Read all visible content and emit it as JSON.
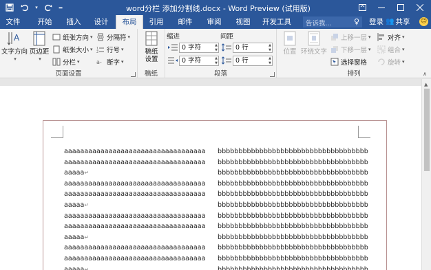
{
  "window": {
    "title": "word分栏 添加分割线.docx - Word Preview (试用版)",
    "qat": {
      "save_icon": "save-icon",
      "undo_icon": "undo-icon",
      "redo_icon": "redo-icon",
      "customize_icon": "customize-qat-icon"
    },
    "controls": {
      "restore": "ribbon-display-icon",
      "minimize": "minimize-icon",
      "maximize": "maximize-icon",
      "close": "close-icon"
    }
  },
  "tabs": [
    "文件",
    "开始",
    "插入",
    "设计",
    "布局",
    "引用",
    "邮件",
    "审阅",
    "视图",
    "开发工具"
  ],
  "active_tab": "布局",
  "tellme": {
    "placeholder": "告诉我..."
  },
  "account": {
    "signin": "登录",
    "share": "共享"
  },
  "ribbon": {
    "page_setup": {
      "label": "页面设置",
      "text_direction": "文字方向",
      "margins": "页边距",
      "orientation": "纸张方向",
      "size": "纸张大小",
      "columns": "分栏",
      "breaks": "分隔符",
      "line_numbers": "行号",
      "hyphenation": "断字"
    },
    "manuscript": {
      "label": "稿纸",
      "button": "稿纸\n设置"
    },
    "paragraph": {
      "label": "段落",
      "indent_title": "缩进",
      "spacing_title": "间距",
      "indent_left": "0 字符",
      "indent_right": "0 字符",
      "spacing_before": "0 行",
      "spacing_after": "0 行"
    },
    "arrange": {
      "label": "排列",
      "position": "位置",
      "wrap_text": "环绕文字",
      "bring_forward": "上移一层",
      "send_backward": "下移一层",
      "selection_pane": "选择窗格",
      "align": "对齐",
      "group": "组合",
      "rotate": "旋转"
    }
  },
  "document": {
    "left_column": [
      "aaaaaaaaaaaaaaaaaaaaaaaaaaaaaaaaaaa",
      "aaaaaaaaaaaaaaaaaaaaaaaaaaaaaaaaaaa",
      "aaaaa",
      "aaaaaaaaaaaaaaaaaaaaaaaaaaaaaaaaaaa",
      "aaaaaaaaaaaaaaaaaaaaaaaaaaaaaaaaaaa",
      "aaaaa",
      "aaaaaaaaaaaaaaaaaaaaaaaaaaaaaaaaaaa",
      "aaaaaaaaaaaaaaaaaaaaaaaaaaaaaaaaaaa",
      "aaaaa",
      "aaaaaaaaaaaaaaaaaaaaaaaaaaaaaaaaaaa",
      "aaaaaaaaaaaaaaaaaaaaaaaaaaaaaaaaaaa",
      "aaaaa"
    ],
    "left_paragraph_end_rows": [
      2,
      5,
      8,
      11
    ],
    "right_column": [
      "bbbbbbbbbbbbbbbbbbbbbbbbbbbbbbbbbbbb",
      "bbbbbbbbbbbbbbbbbbbbbbbbbbbbbbbbbbbb",
      "bbbbbbbbbbbbbbbbbbbbbbbbbbbbbbbbbbbb",
      "bbbbbbbbbbbbbbbbbbbbbbbbbbbbbbbbbbbb",
      "bbbbbbbbbbbbbbbbbbbbbbbbbbbbbbbbbbbb",
      "bbbbbbbbbbbbbbbbbbbbbbbbbbbbbbbbbbbb",
      "bbbbbbbbbbbbbbbbbbbbbbbbbbbbbbbbbbbb",
      "bbbbbbbbbbbbbbbbbbbbbbbbbbbbbbbbbbbb",
      "bbbbbbbbbbbbbbbbbbbbbbbbbbbbbbbbbbbb",
      "bbbbbbbbbbbbbbbbbbbbbbbbbbbbbbbbbbbb",
      "bbbbbbbbbbbbbbbbbbbbbbbbbbbbbbbbbbbb",
      "bbbbbbbbbbbbbbbbbbbbbbbbbbbbbbbbbbbb"
    ],
    "paragraph_mark": "↵"
  },
  "colors": {
    "accent": "#2b579a",
    "ribbon_bg": "#f3f3f3",
    "margin_line": "#b89292"
  }
}
